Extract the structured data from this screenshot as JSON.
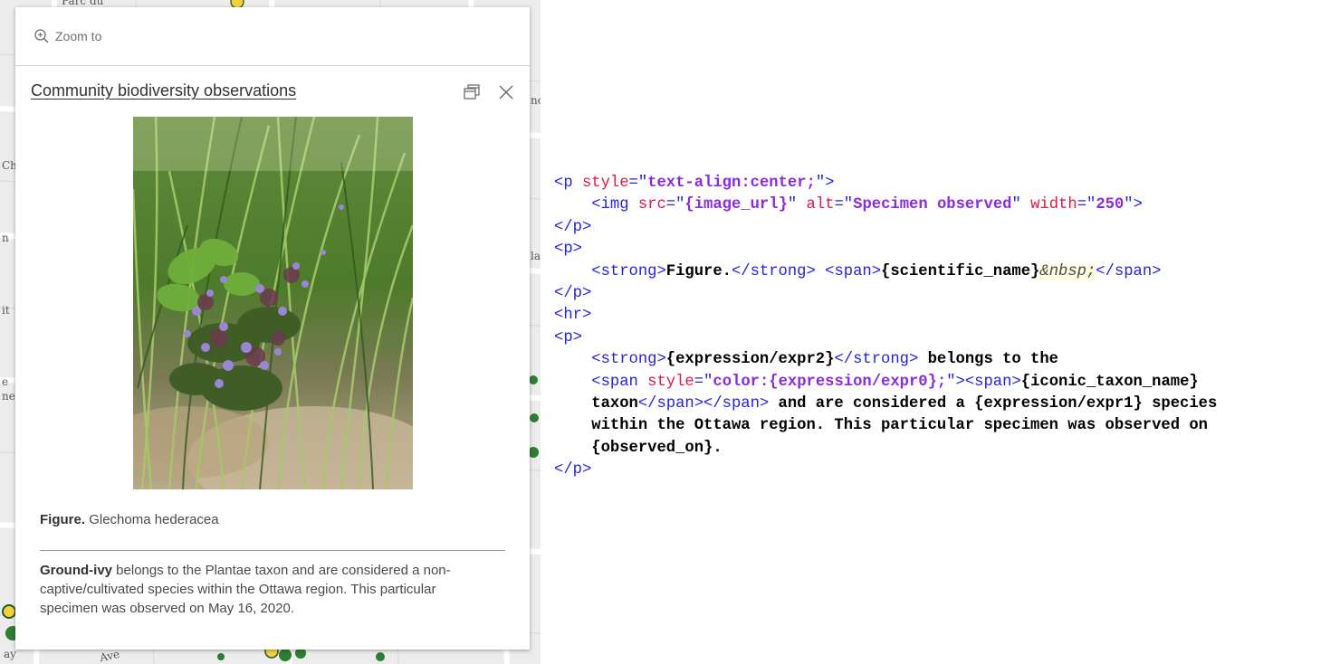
{
  "map": {
    "labels": [
      "Parc du",
      "Ch",
      "n",
      "it",
      "la",
      "e",
      "ne",
      "nc",
      "ay",
      "Ave"
    ]
  },
  "popup": {
    "zoom_label": "Zoom to",
    "title": "Community biodiversity observations",
    "photo_alt": "Specimen observed",
    "figure_label": "Figure.",
    "scientific_name": "Glechoma hederacea",
    "common_name": "Ground-ivy",
    "description": {
      "part1": " belongs to the ",
      "taxon": "Plantae",
      "part2": " taxon and are considered a non-captive/cultivated species within the Ottawa region. This particular specimen was observed on ",
      "date": "May 16, 2020",
      "end": "."
    }
  },
  "code": {
    "l1_open": "<p ",
    "l1_attr": "style",
    "l1_eq": "=\"",
    "l1_val": "text-align:center;",
    "l1_close": "\">",
    "l2_open": "    <img ",
    "l2_a1": "src",
    "l2_q1": "=\"",
    "l2_v1": "{image_url}",
    "l2_q1e": "\" ",
    "l2_a2": "alt",
    "l2_q2": "=\"",
    "l2_v2": "Specimen observed",
    "l2_q2e": "\" ",
    "l2_a3": "width",
    "l2_q3": "=\"",
    "l2_v3": "250",
    "l2_close": "\">",
    "l3": "</p>",
    "l4": "<p>",
    "l5_open": "    <strong>",
    "l5_fig": "Figure.",
    "l5_strong_close": "</strong> ",
    "l5_span": "<span>",
    "l5_sci": "{scientific_name}",
    "l5_nbsp": "&nbsp;",
    "l5_span_close": "</span>",
    "l6": "</p>",
    "l7": "<hr>",
    "l8": "<p>",
    "l9_open": "    <strong>",
    "l9_expr": "{expression/expr2}",
    "l9_close": "</strong>",
    "l9_text": " belongs to the",
    "l10_open": "    <span ",
    "l10_attr": "style",
    "l10_eq": "=\"",
    "l10_val": "color:{expression/expr0};",
    "l10_close": "\"><span>",
    "l10_text": "{iconic_taxon_name}",
    "l11_text": "    taxon",
    "l11_close": "</span></span>",
    "l11_text2": " and are considered a {expression/expr1} species",
    "l12": "    within the Ottawa region. This particular specimen was observed on",
    "l13": "    {observed_on}.",
    "l14": "</p>"
  }
}
